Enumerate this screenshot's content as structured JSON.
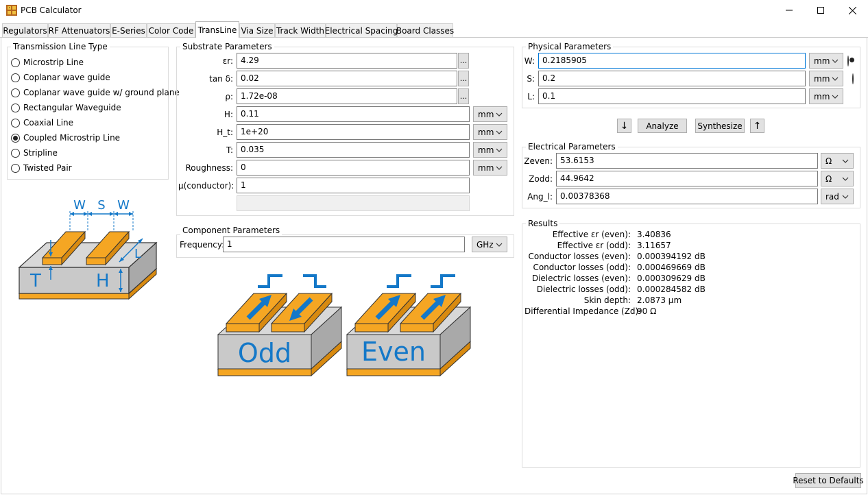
{
  "window": {
    "title": "PCB Calculator",
    "minimize_glyph": "—",
    "maximize_glyph": "☐",
    "close_glyph": "✕"
  },
  "tabs": [
    "Regulators",
    "RF Attenuators",
    "E-Series",
    "Color Code",
    "TransLine",
    "Via Size",
    "Track Width",
    "Electrical Spacing",
    "Board Classes"
  ],
  "active_tab": "TransLine",
  "line_type": {
    "title": "Transmission Line Type",
    "options": [
      "Microstrip Line",
      "Coplanar wave guide",
      "Coplanar wave guide w/ ground plane",
      "Rectangular Waveguide",
      "Coaxial Line",
      "Coupled Microstrip Line",
      "Stripline",
      "Twisted Pair"
    ],
    "selected": "Coupled Microstrip Line"
  },
  "substrate": {
    "title": "Substrate Parameters",
    "rows": [
      {
        "label": "εr:",
        "value": "4.29",
        "extra": "..."
      },
      {
        "label": "tan δ:",
        "value": "0.02",
        "extra": "..."
      },
      {
        "label": "ρ:",
        "value": "1.72e-08",
        "extra": "..."
      },
      {
        "label": "H:",
        "value": "0.11",
        "unit": "mm"
      },
      {
        "label": "H_t:",
        "value": "1e+20",
        "unit": "mm"
      },
      {
        "label": "T:",
        "value": "0.035",
        "unit": "mm"
      },
      {
        "label": "Roughness:",
        "value": "0",
        "unit": "mm"
      },
      {
        "label": "μ(conductor):",
        "value": "1"
      }
    ]
  },
  "component": {
    "title": "Component Parameters",
    "frequency_label": "Frequency:",
    "frequency_value": "1",
    "frequency_unit": "GHz"
  },
  "physical": {
    "title": "Physical Parameters",
    "rows": [
      {
        "label": "W:",
        "value": "0.2185905",
        "unit": "mm",
        "radio": true,
        "checked": true
      },
      {
        "label": "S:",
        "value": "0.2",
        "unit": "mm",
        "radio": true,
        "checked": false
      },
      {
        "label": "L:",
        "value": "0.1",
        "unit": "mm"
      }
    ]
  },
  "actions": {
    "analyze": "Analyze",
    "synthesize": "Synthesize",
    "down_arrow": "↓",
    "up_arrow": "↑"
  },
  "electrical": {
    "title": "Electrical Parameters",
    "rows": [
      {
        "label": "Zeven:",
        "value": "53.6153",
        "unit": "Ω"
      },
      {
        "label": "Zodd:",
        "value": "44.9642",
        "unit": "Ω"
      },
      {
        "label": "Ang_l:",
        "value": "0.00378368",
        "unit": "rad"
      }
    ]
  },
  "results": {
    "title": "Results",
    "rows": [
      {
        "label": "Effective εr (even):",
        "value": "3.40836"
      },
      {
        "label": "Effective εr (odd):",
        "value": "3.11657"
      },
      {
        "label": "Conductor losses (even):",
        "value": "0.000394192 dB"
      },
      {
        "label": "Conductor losses (odd):",
        "value": "0.000469669 dB"
      },
      {
        "label": "Dielectric losses (even):",
        "value": "0.000309629 dB"
      },
      {
        "label": "Dielectric losses (odd):",
        "value": "0.000284582 dB"
      },
      {
        "label": "Skin depth:",
        "value": "2.0873 µm"
      },
      {
        "label": "Differential Impedance (Zd):",
        "value": "90 Ω"
      }
    ]
  },
  "reset_button": "Reset to Defaults",
  "diagram": {
    "labels": {
      "w1": "W",
      "s": "S",
      "w2": "W",
      "l": "L",
      "t": "T",
      "h": "H"
    },
    "odd_label": "Odd",
    "even_label": "Even"
  },
  "colors": {
    "trace": "#f5a623",
    "trace_dark": "#d88a10",
    "substrate": "#c9c9c9",
    "annotation_blue": "#1478c8",
    "focus_blue": "#0078d7"
  }
}
